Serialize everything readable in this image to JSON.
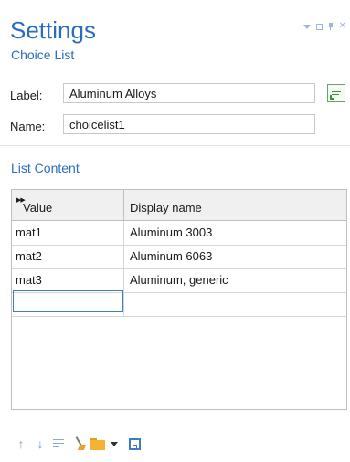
{
  "header": {
    "title": "Settings",
    "subtitle": "Choice List"
  },
  "form": {
    "label_caption": "Label:",
    "label_value": "Aluminum Alloys",
    "name_caption": "Name:",
    "name_value": "choicelist1"
  },
  "section": {
    "title": "List Content"
  },
  "table": {
    "columns": [
      "Value",
      "Display name"
    ],
    "rows": [
      {
        "value": "mat1",
        "display": "Aluminum 3003"
      },
      {
        "value": "mat2",
        "display": "Aluminum 6063"
      },
      {
        "value": "mat3",
        "display": "Aluminum, generic"
      },
      {
        "value": "",
        "display": ""
      }
    ]
  },
  "toolbar": {
    "icons": [
      "move-up-icon",
      "move-down-icon",
      "delete-icon",
      "clear-table-icon",
      "load-from-file-icon",
      "dropdown-arrow-icon",
      "save-to-file-icon"
    ]
  },
  "colors": {
    "accent": "#2a6ebb",
    "selection_border": "#3e7cc5",
    "header_bg": "#f0f0f0"
  }
}
